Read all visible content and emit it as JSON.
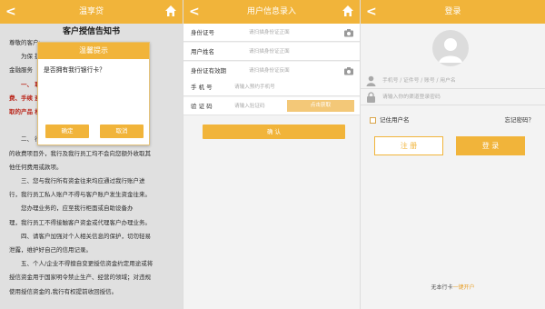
{
  "panel1": {
    "header_title": "温享贷",
    "doc_title": "客户授信告知书",
    "doc_lines": [
      {
        "text": "尊敬的客户:",
        "style": "normal"
      },
      {
        "text": "　　为保                                              提供的",
        "style": "normal"
      },
      {
        "text": "金融服务",
        "style": "normal"
      },
      {
        "text": "　　一、                                                  取中介",
        "style": "red"
      },
      {
        "text": "费、手续                                               遵误获",
        "style": "red"
      },
      {
        "text": "取的产品                                                 权益。",
        "style": "red"
      },
      {
        "text": "",
        "style": "normal"
      },
      {
        "text": "　　二、                                                 行公示",
        "style": "normal"
      },
      {
        "text": "的收费项目外，我行及我行员工均不会向您额外收取其",
        "style": "normal"
      },
      {
        "text": "他任何费用或款项。",
        "style": "normal"
      },
      {
        "text": "　　三、您与我行所有资金往来均应通过我行账户进",
        "style": "normal"
      },
      {
        "text": "行，我行员工私人账户不得与客户账户发生资金往来。",
        "style": "normal"
      },
      {
        "text": "　　您办理业务的，应至我行柜面或自助设备办",
        "style": "normal"
      },
      {
        "text": "理，我行员工不得接触客户资金或代理客户办理业务。",
        "style": "normal"
      },
      {
        "text": "　　四、请客户加强对个人相关信息的保护，切勿轻易",
        "style": "normal"
      },
      {
        "text": "泄露，维护好自己的信用记录。",
        "style": "normal"
      },
      {
        "text": "　　五、个人/企业不得擅自变更授信资金约定用途或将",
        "style": "normal"
      },
      {
        "text": "授信资金用于国家明令禁止生产、经营的领域；对违规",
        "style": "normal"
      },
      {
        "text": "使用授信资金的,我行有权提前收回授信。",
        "style": "normal"
      }
    ],
    "dialog": {
      "title": "温馨提示",
      "message": "是否拥有我行银行卡？",
      "confirm_label": "确定",
      "cancel_label": "取消"
    }
  },
  "panel2": {
    "header_title": "用户信息录入",
    "rows": [
      {
        "label": "身份证号",
        "placeholder": "请扫描身份证正面"
      },
      {
        "label": "用户姓名",
        "placeholder": "请扫描身份证正面"
      },
      {
        "label": "身份证有效期",
        "placeholder": "请扫描身份证反面"
      },
      {
        "label": "手 机 号",
        "placeholder": "请输入预约手机号"
      },
      {
        "label": "验 证 码",
        "placeholder": "请输入验证码"
      }
    ],
    "code_button": "点击获取",
    "confirm_label": "确 认"
  },
  "panel3": {
    "header_title": "登录",
    "username_placeholder": "手机号 / 证件号 / 账号 / 用户名",
    "password_placeholder": "请输入你的渠道登录密码",
    "remember_label": "记住用户名",
    "forgot_label": "忘记密码？",
    "register_label": "注 册",
    "login_label": "登 录",
    "footer_text": "无本行卡",
    "footer_link": "一键开户"
  },
  "colors": {
    "accent": "#f1b43a",
    "red_text": "#d42b1e",
    "disabled_button": "#f3c878"
  },
  "icons": {
    "back": "back-arrow-icon",
    "home": "home-icon",
    "camera": "camera-icon",
    "avatar": "user-avatar-icon",
    "user": "user-icon",
    "lock": "lock-icon"
  }
}
